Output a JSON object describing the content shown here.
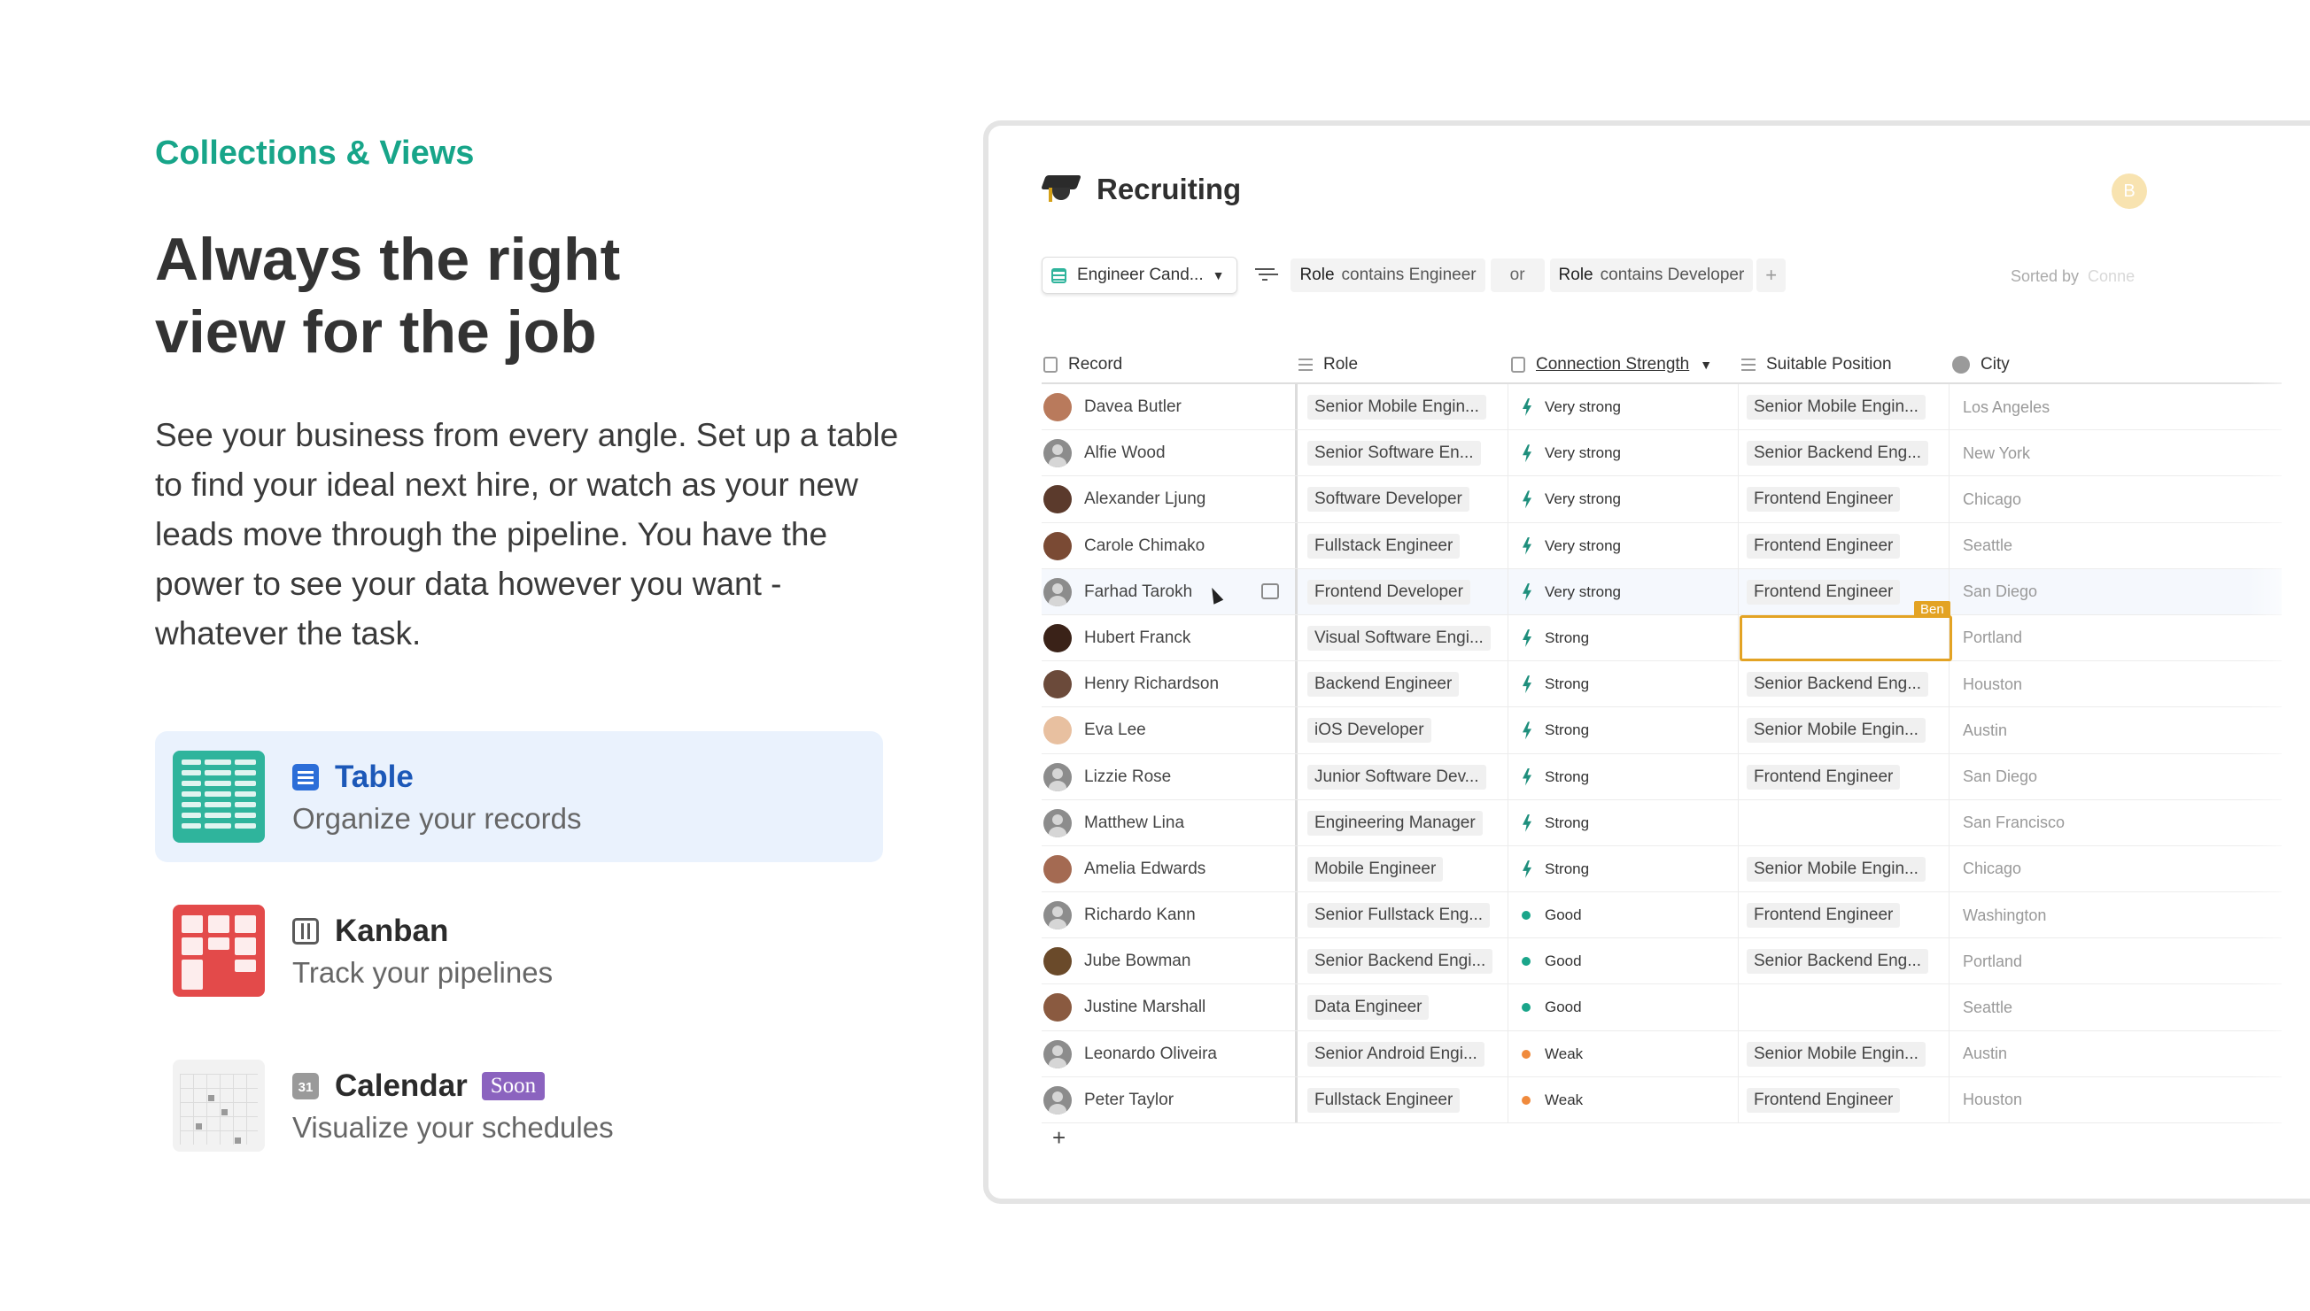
{
  "marketing": {
    "eyebrow": "Collections & Views",
    "headline_line1": "Always the right",
    "headline_line2": "view for the job",
    "lead": "See your business from every angle. Set up a table to find your ideal next hire, or watch as your new leads move through the pipeline. You have the power to see your data however you want - whatever the task."
  },
  "views": [
    {
      "title": "Table",
      "subtitle": "Organize your records",
      "icon": "table-icon",
      "active": true
    },
    {
      "title": "Kanban",
      "subtitle": "Track your pipelines",
      "icon": "kanban-icon",
      "active": false
    },
    {
      "title": "Calendar",
      "subtitle": "Visualize your schedules",
      "icon": "calendar-icon",
      "badge": "Soon",
      "icon_text": "31",
      "active": false
    }
  ],
  "app": {
    "title": "Recruiting",
    "avatar_letter": "B",
    "view_select": "Engineer Cand...",
    "filters": [
      {
        "field": "Role",
        "op": "contains Engineer"
      },
      {
        "field": "Role",
        "op": "contains Developer"
      }
    ],
    "or_label": "or",
    "add_filter": "+",
    "sorted_label": "Sorted by",
    "sorted_field": "Conne",
    "columns": [
      "Record",
      "Role",
      "Connection Strength",
      "Suitable Position",
      "City"
    ],
    "add_row": "+",
    "cell_tag": "Ben",
    "rows": [
      {
        "name": "Davea Butler",
        "role": "Senior Mobile Engin...",
        "strength": "Very strong",
        "position": "Senior Mobile Engin...",
        "city": "Los Angeles"
      },
      {
        "name": "Alfie Wood",
        "role": "Senior Software En...",
        "strength": "Very strong",
        "position": "Senior Backend Eng...",
        "city": "New York"
      },
      {
        "name": "Alexander Ljung",
        "role": "Software Developer",
        "strength": "Very strong",
        "position": "Frontend Engineer",
        "city": "Chicago"
      },
      {
        "name": "Carole Chimako",
        "role": "Fullstack Engineer",
        "strength": "Very strong",
        "position": "Frontend Engineer",
        "city": "Seattle"
      },
      {
        "name": "Farhad Tarokh",
        "role": "Frontend Developer",
        "strength": "Very strong",
        "position": "Frontend Engineer",
        "city": "San Diego"
      },
      {
        "name": "Hubert Franck",
        "role": "Visual Software Engi...",
        "strength": "Strong",
        "position": "",
        "city": "Portland"
      },
      {
        "name": "Henry Richardson",
        "role": "Backend Engineer",
        "strength": "Strong",
        "position": "Senior Backend Eng...",
        "city": "Houston"
      },
      {
        "name": "Eva Lee",
        "role": "iOS Developer",
        "strength": "Strong",
        "position": "Senior Mobile Engin...",
        "city": "Austin"
      },
      {
        "name": "Lizzie Rose",
        "role": "Junior Software Dev...",
        "strength": "Strong",
        "position": "Frontend Engineer",
        "city": "San Diego"
      },
      {
        "name": "Matthew Lina",
        "role": "Engineering Manager",
        "strength": "Strong",
        "position": "",
        "city": "San Francisco"
      },
      {
        "name": "Amelia Edwards",
        "role": "Mobile Engineer",
        "strength": "Strong",
        "position": "Senior Mobile Engin...",
        "city": "Chicago"
      },
      {
        "name": "Richardo Kann",
        "role": "Senior Fullstack Eng...",
        "strength": "Good",
        "position": "Frontend Engineer",
        "city": "Washington"
      },
      {
        "name": "Jube Bowman",
        "role": "Senior Backend Engi...",
        "strength": "Good",
        "position": "Senior Backend Eng...",
        "city": "Portland"
      },
      {
        "name": "Justine Marshall",
        "role": "Data Engineer",
        "strength": "Good",
        "position": "",
        "city": "Seattle"
      },
      {
        "name": "Leonardo Oliveira",
        "role": "Senior Android Engi...",
        "strength": "Weak",
        "position": "Senior Mobile Engin...",
        "city": "Austin"
      },
      {
        "name": "Peter Taylor",
        "role": "Fullstack Engineer",
        "strength": "Weak",
        "position": "Frontend Engineer",
        "city": "Houston"
      }
    ],
    "avatar_colors": [
      "#b97a5c",
      "gray",
      "#5b3a2c",
      "#7a4a34",
      "gray",
      "#3a2218",
      "#6b4a3a",
      "#e8c0a0",
      "gray",
      "gray",
      "#a46a52",
      "gray",
      "#6a4a2a",
      "#8a5a40",
      "gray",
      "gray"
    ],
    "strength_colors": {
      "Good": "#1aa58a",
      "Weak": "#f08a3c"
    },
    "colors": {
      "accent_teal": "#17a589",
      "active_blue": "#1c58b8",
      "selection": "#e3a324",
      "soon_badge": "#8b63bf"
    }
  }
}
